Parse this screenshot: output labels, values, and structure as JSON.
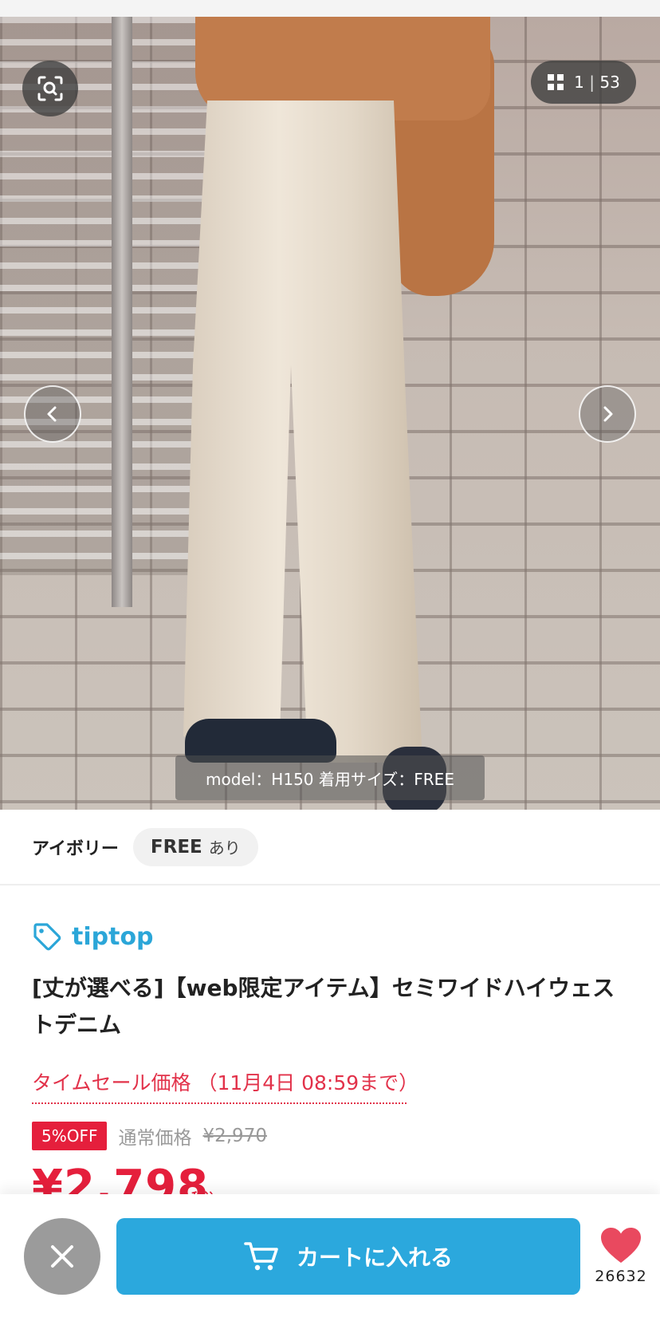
{
  "gallery": {
    "current": "1",
    "total": "53",
    "caption": "model：H150 着用サイズ：FREE"
  },
  "variant": {
    "color": "アイボリー",
    "size": "FREE",
    "stock": "あり"
  },
  "product": {
    "brand": "tiptop",
    "title": "[丈が選べる]【web限定アイテム】セミワイドハイウェストデニム",
    "sale_label": "タイムセール価格 （11月4日 08:59まで）",
    "off_badge": "5%OFF",
    "regular_label": "通常価格",
    "regular_price": "¥2,970",
    "sale_price": "¥2,798",
    "tax": "税込"
  },
  "actions": {
    "cart_label": "カートに入れる",
    "favorite_count": "26632"
  },
  "colors": {
    "accent": "#2ba8dd",
    "sale": "#e51f3c"
  },
  "icons": [
    "zoom-icon",
    "grid-icon",
    "chevron-left-icon",
    "chevron-right-icon",
    "tag-icon",
    "close-icon",
    "cart-icon",
    "heart-icon"
  ]
}
